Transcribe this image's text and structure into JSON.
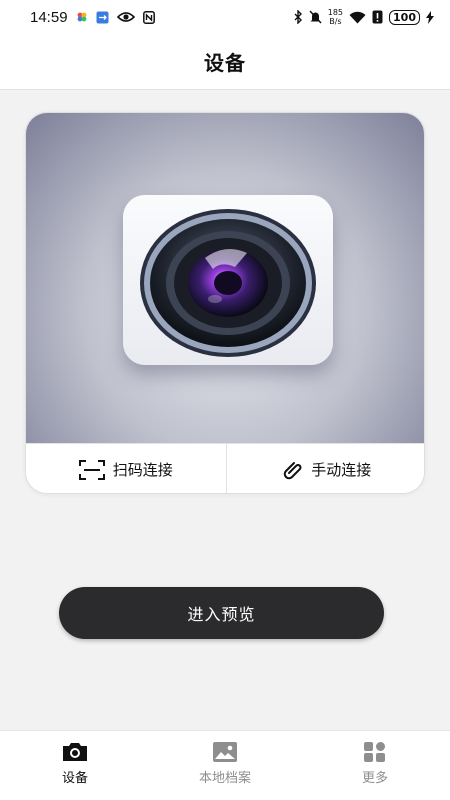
{
  "status_bar": {
    "time": "14:59",
    "net_speed_value": "185",
    "net_speed_unit": "B/s",
    "battery": "100"
  },
  "header": {
    "title": "设备"
  },
  "device_card": {
    "scan_connect_label": "扫码连接",
    "manual_connect_label": "手动连接"
  },
  "preview_button": {
    "label": "进入预览"
  },
  "bottom_nav": {
    "items": [
      {
        "label": "设备",
        "icon": "camera-icon",
        "active": true
      },
      {
        "label": "本地档案",
        "icon": "image-icon",
        "active": false
      },
      {
        "label": "更多",
        "icon": "grid-icon",
        "active": false
      }
    ]
  },
  "colors": {
    "preview_button_bg": "#2b2b2d",
    "page_bg": "#f2f2f2",
    "nav_active": "#111111",
    "nav_inactive": "#8e8e8e"
  }
}
